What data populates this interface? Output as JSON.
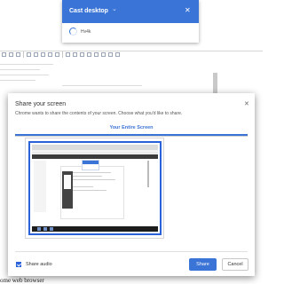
{
  "cast": {
    "title": "Cast desktop",
    "chevron": "⌄",
    "close": "✕",
    "device": "Hv4k"
  },
  "dialog": {
    "title": "Share your screen",
    "close": "✕",
    "description": "Chrome wants to share the contents of your screen. Choose what you'd like to share.",
    "tab_label": "Your Entire Screen",
    "share_audio_label": "Share audio",
    "share_audio_checked": true,
    "share_button": "Share",
    "cancel_button": "Cancel"
  },
  "background": {
    "bottom_text": "ome web browser"
  },
  "colors": {
    "accent": "#3a74d6",
    "selection": "#2a63d9"
  },
  "icons": {
    "cast_spinner": "loading-spinner-icon",
    "close": "close-icon",
    "chevron": "chevron-down-icon",
    "checkbox": "checkbox-checked-icon"
  }
}
